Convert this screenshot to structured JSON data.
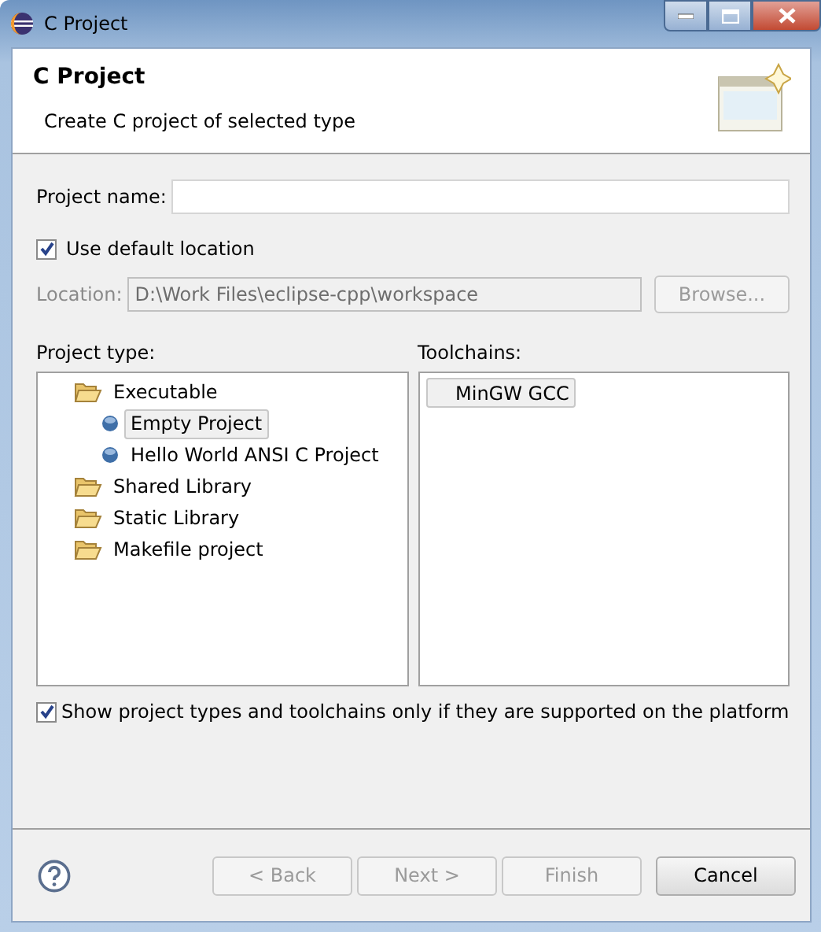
{
  "window": {
    "title": "C Project"
  },
  "header": {
    "title": "C Project",
    "subtitle": "Create C project of selected type"
  },
  "project_name": {
    "label": "Project name:"
  },
  "use_default_location": {
    "label": "Use default location",
    "checked": true
  },
  "location": {
    "label": "Location:",
    "value": "D:\\Work Files\\eclipse-cpp\\workspace",
    "disabled": true
  },
  "browse_button": {
    "label": "Browse...",
    "disabled": true
  },
  "project_type": {
    "label": "Project type:",
    "items": [
      {
        "kind": "folder",
        "label": "Executable",
        "selected": false,
        "children": [
          {
            "kind": "project",
            "label": "Empty Project",
            "selected": true
          },
          {
            "kind": "project",
            "label": "Hello World ANSI C Project",
            "selected": false
          }
        ]
      },
      {
        "kind": "folder",
        "label": "Shared Library",
        "selected": false
      },
      {
        "kind": "folder",
        "label": "Static Library",
        "selected": false
      },
      {
        "kind": "folder",
        "label": "Makefile project",
        "selected": false
      }
    ]
  },
  "toolchains": {
    "label": "Toolchains:",
    "items": [
      {
        "label": "MinGW GCC",
        "selected": true
      }
    ]
  },
  "show_supported": {
    "label": "Show project types and toolchains only if they are supported on the platform",
    "checked": true
  },
  "buttons": [
    {
      "label": "< Back",
      "disabled": true
    },
    {
      "label": "Next >",
      "disabled": true
    },
    {
      "label": "Finish",
      "disabled": true
    },
    {
      "label": "Cancel",
      "disabled": false
    }
  ]
}
